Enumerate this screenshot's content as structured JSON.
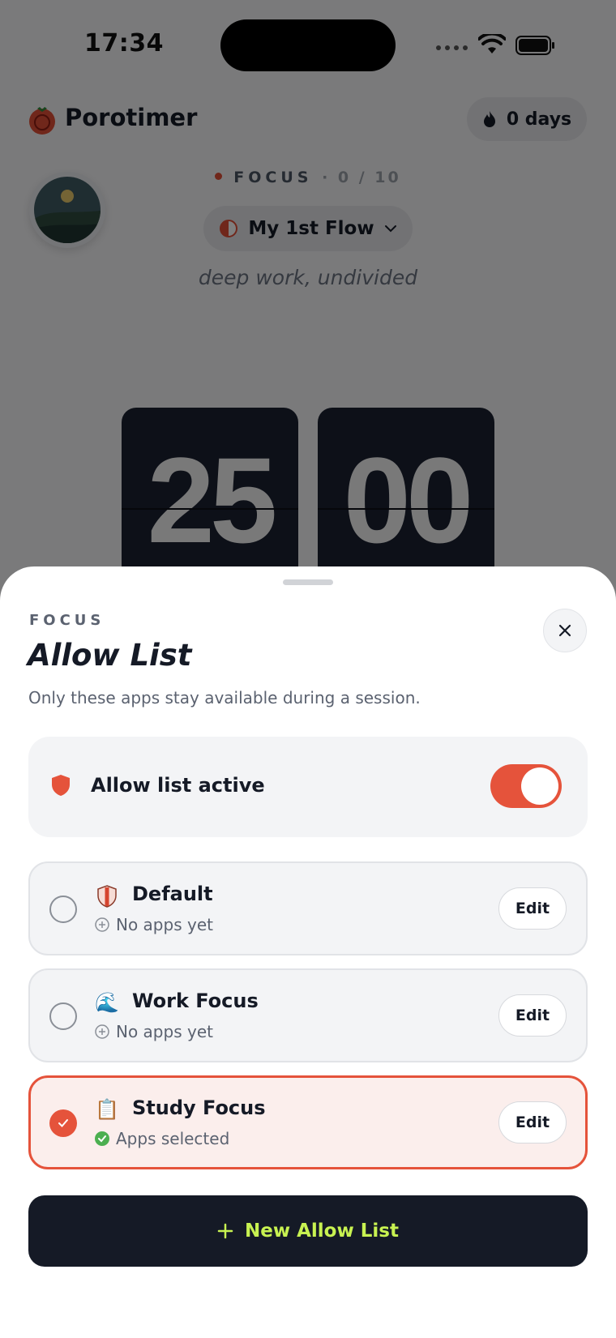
{
  "status_bar": {
    "time": "17:34"
  },
  "header": {
    "app_name": "Porotimer",
    "streak_label": "0 days"
  },
  "session": {
    "mode_label": "FOCUS",
    "mode_count": "· 0 / 10",
    "flow_name": "My 1st Flow",
    "tagline": "deep work, undivided",
    "timer_minutes": "25",
    "timer_seconds": "00"
  },
  "sheet": {
    "kicker": "FOCUS",
    "title": "Allow List",
    "subtitle": "Only these apps stay available during a session.",
    "toggle": {
      "label": "Allow list active",
      "on": true
    }
  },
  "allow_lists": [
    {
      "name": "Default",
      "emoji": "shield",
      "status": "No apps yet",
      "selected": false,
      "edit_label": "Edit"
    },
    {
      "name": "Work Focus",
      "emoji": "🌊",
      "status": "No apps yet",
      "selected": false,
      "edit_label": "Edit"
    },
    {
      "name": "Study Focus",
      "emoji": "📋",
      "status": "Apps selected",
      "selected": true,
      "edit_label": "Edit"
    }
  ],
  "new_button": {
    "label": "New Allow List"
  },
  "colors": {
    "accent": "#e5533b",
    "dark": "#151a26",
    "lime": "#c8f251"
  },
  "icons": [
    "tomato-logo-icon",
    "flame-icon",
    "half-circle-icon",
    "chevron-down-icon",
    "close-icon",
    "shield-icon",
    "plus-circle-icon",
    "check-circle-icon",
    "plus-icon"
  ]
}
